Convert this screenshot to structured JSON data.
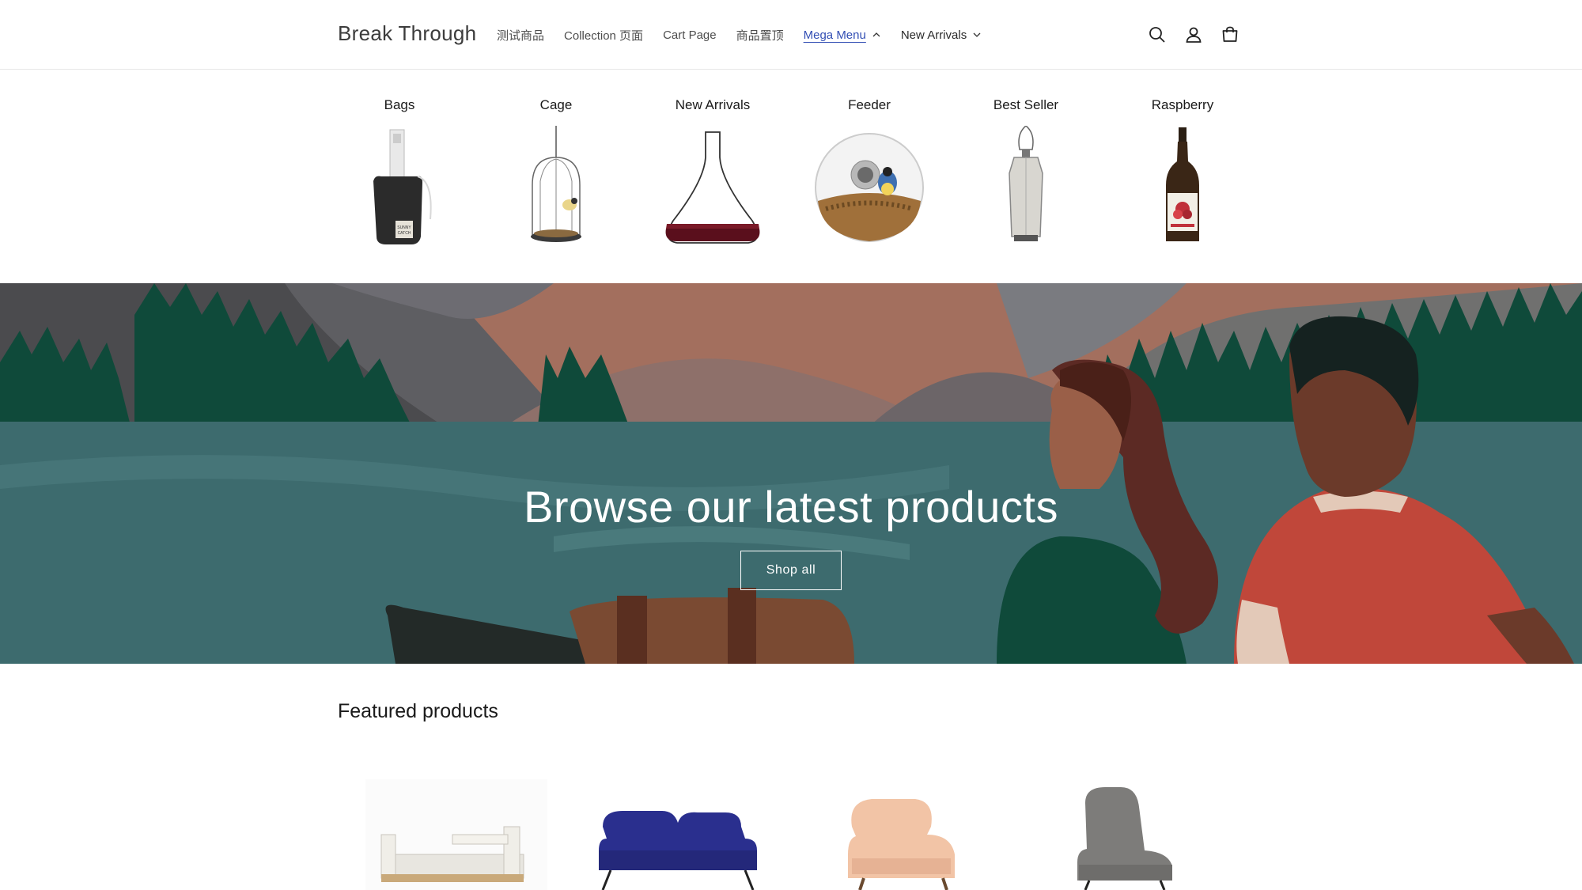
{
  "header": {
    "logo": "Break Through",
    "nav": [
      {
        "label": "测试商品",
        "has_dropdown": false
      },
      {
        "label": "Collection 页面",
        "has_dropdown": false
      },
      {
        "label": "Cart Page",
        "has_dropdown": false
      },
      {
        "label": "商品置顶",
        "has_dropdown": false
      },
      {
        "label": "Mega Menu",
        "has_dropdown": true,
        "expanded": true
      },
      {
        "label": "New Arrivals",
        "has_dropdown": true,
        "expanded": false
      }
    ],
    "icons": [
      "search-icon",
      "account-icon",
      "cart-icon"
    ]
  },
  "mega_menu": {
    "items": [
      {
        "label": "Bags",
        "image": "bag-planter"
      },
      {
        "label": "Cage",
        "image": "bird-cage"
      },
      {
        "label": "New Arrivals",
        "image": "wine-decanter"
      },
      {
        "label": "Feeder",
        "image": "window-bird-feeder"
      },
      {
        "label": "Best Seller",
        "image": "hanging-lantern"
      },
      {
        "label": "Raspberry",
        "image": "raspberry-bottle"
      }
    ]
  },
  "hero": {
    "title": "Browse our latest products",
    "button": "Shop all"
  },
  "featured": {
    "title": "Featured products",
    "products": [
      "toddler-bed",
      "blue-sofa",
      "peach-lounge-chair",
      "grey-high-back-chair"
    ]
  },
  "colors": {
    "accent_link": "#334fb4",
    "hero_water": "#3d6b6e",
    "hero_trees": "#0f4a3a"
  }
}
